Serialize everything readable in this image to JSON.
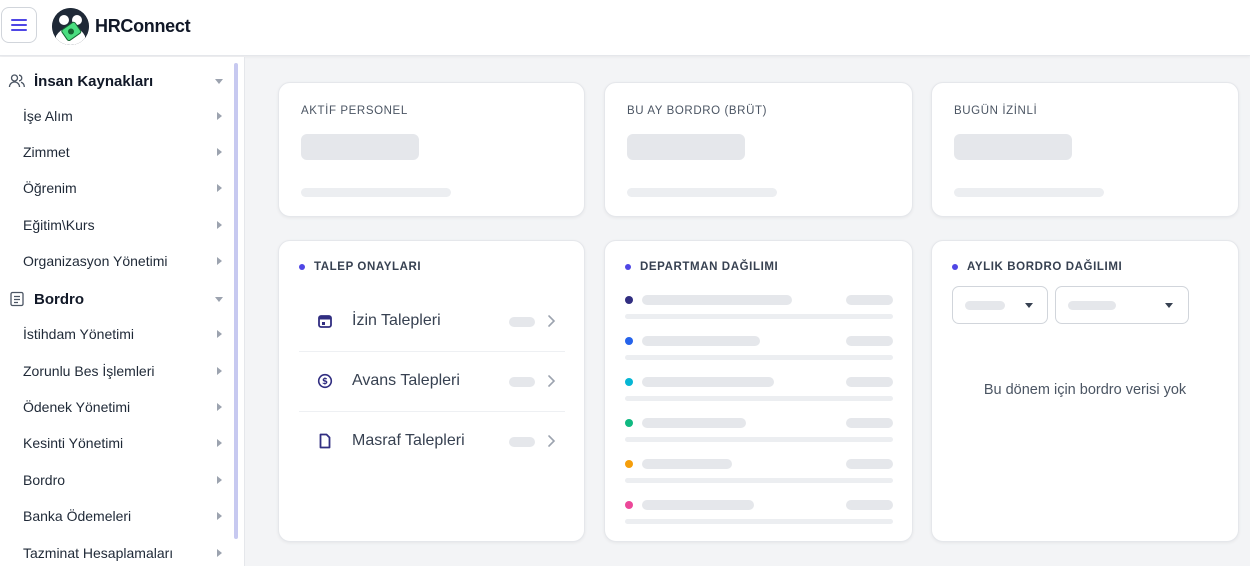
{
  "header": {
    "app_name": "HRConnect",
    "menu_icon": "hamburger-icon",
    "logo_icon": "hrconnect-logo"
  },
  "sidebar": {
    "groups": [
      {
        "label": "İnsan Kaynakları",
        "icon": "users-icon",
        "items": [
          "İşe Alım",
          "Zimmet",
          "Öğrenim",
          "Eğitim\\Kurs",
          "Organizasyon Yönetimi"
        ]
      },
      {
        "label": "Bordro",
        "icon": "document-icon",
        "items": [
          "İstihdam Yönetimi",
          "Zorunlu Bes İşlemleri",
          "Ödenek Yönetimi",
          "Kesinti Yönetimi",
          "Bordro",
          "Banka Ödemeleri",
          "Tazminat Hesaplamaları"
        ]
      }
    ]
  },
  "stats": {
    "active_staff_label": "AKTİF PERSONEL",
    "payroll_label": "BU AY BORDRO (BRÜT)",
    "on_leave_label": "BUGÜN İZİNLİ"
  },
  "approvals": {
    "title": "TALEP ONAYLARI",
    "items": [
      {
        "label": "İzin Talepleri",
        "icon": "calendar-icon"
      },
      {
        "label": "Avans Talepleri",
        "icon": "dollar-circle-icon"
      },
      {
        "label": "Masraf Talepleri",
        "icon": "file-icon"
      }
    ]
  },
  "departments": {
    "title": "DEPARTMAN DAĞILIMI",
    "dot_colors": [
      "#312e81",
      "#2563eb",
      "#06b6d4",
      "#10b981",
      "#f59e0b",
      "#ec4899"
    ]
  },
  "monthly_payroll": {
    "title": "AYLIK BORDRO DAĞILIMI",
    "empty_text": "Bu dönem için bordro verisi yok"
  },
  "colors": {
    "accent": "#4f46e5",
    "skeleton": "#e5e7eb"
  }
}
